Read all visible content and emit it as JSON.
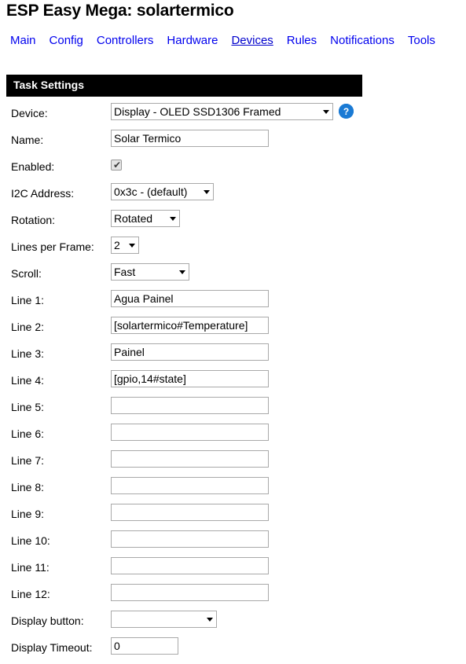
{
  "header": {
    "title": "ESP Easy Mega: solartermico"
  },
  "nav": {
    "items": [
      {
        "label": "Main",
        "active": false
      },
      {
        "label": "Config",
        "active": false
      },
      {
        "label": "Controllers",
        "active": false
      },
      {
        "label": "Hardware",
        "active": false
      },
      {
        "label": "Devices",
        "active": true
      },
      {
        "label": "Rules",
        "active": false
      },
      {
        "label": "Notifications",
        "active": false
      },
      {
        "label": "Tools",
        "active": false
      }
    ]
  },
  "section": {
    "title": "Task Settings"
  },
  "form": {
    "device": {
      "label": "Device:",
      "value": "Display - OLED SSD1306 Framed",
      "help_icon": "question-mark-help-icon"
    },
    "name": {
      "label": "Name:",
      "value": "Solar Termico",
      "placeholder": ""
    },
    "enabled": {
      "label": "Enabled:",
      "checked": true,
      "tick": "✔"
    },
    "i2c_address": {
      "label": "I2C Address:",
      "value": "0x3c - (default)"
    },
    "rotation": {
      "label": "Rotation:",
      "value": "Rotated"
    },
    "lines_per_frame": {
      "label": "Lines per Frame:",
      "value": "2"
    },
    "scroll": {
      "label": "Scroll:",
      "value": "Fast"
    },
    "lines": [
      {
        "label": "Line 1:",
        "value": "Agua Painel"
      },
      {
        "label": "Line 2:",
        "value": "[solartermico#Temperature]"
      },
      {
        "label": "Line 3:",
        "value": "Painel"
      },
      {
        "label": "Line 4:",
        "value": "[gpio,14#state]"
      },
      {
        "label": "Line 5:",
        "value": ""
      },
      {
        "label": "Line 6:",
        "value": ""
      },
      {
        "label": "Line 7:",
        "value": ""
      },
      {
        "label": "Line 8:",
        "value": ""
      },
      {
        "label": "Line 9:",
        "value": ""
      },
      {
        "label": "Line 10:",
        "value": ""
      },
      {
        "label": "Line 11:",
        "value": ""
      },
      {
        "label": "Line 12:",
        "value": ""
      }
    ],
    "display_button": {
      "label": "Display button:",
      "value": ""
    },
    "display_timeout": {
      "label": "Display Timeout:",
      "value": "0"
    }
  },
  "colors": {
    "link": "#0000ee",
    "link_active": "#0000cc",
    "section_bar_bg": "#000000",
    "section_bar_text": "#ffffff",
    "help_icon_bg": "#1a7ad4",
    "input_border": "#a9a9a9",
    "page_bg": "#ffffff"
  }
}
